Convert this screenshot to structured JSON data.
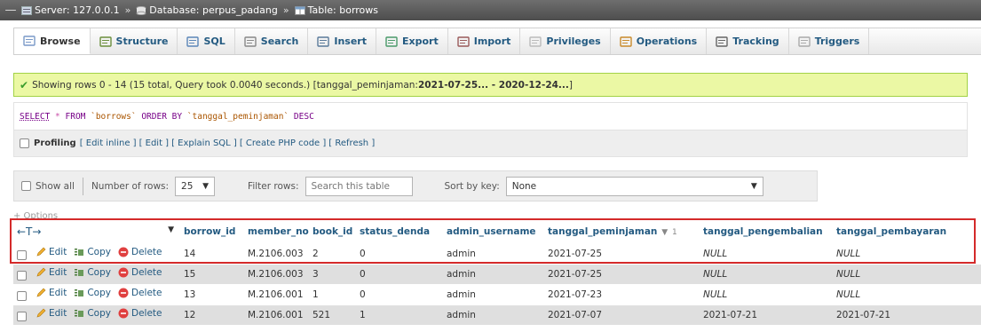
{
  "breadcrumb": {
    "server": "Server: 127.0.0.1",
    "database": "Database: perpus_padang",
    "table": "Table: borrows",
    "separator": "»"
  },
  "tabs": [
    {
      "label": "Browse",
      "icon": "browse-icon",
      "active": true
    },
    {
      "label": "Structure",
      "icon": "structure-icon"
    },
    {
      "label": "SQL",
      "icon": "sql-icon"
    },
    {
      "label": "Search",
      "icon": "search-icon"
    },
    {
      "label": "Insert",
      "icon": "insert-icon"
    },
    {
      "label": "Export",
      "icon": "export-icon"
    },
    {
      "label": "Import",
      "icon": "import-icon"
    },
    {
      "label": "Privileges",
      "icon": "privileges-icon"
    },
    {
      "label": "Operations",
      "icon": "operations-icon"
    },
    {
      "label": "Tracking",
      "icon": "tracking-icon"
    },
    {
      "label": "Triggers",
      "icon": "triggers-icon"
    }
  ],
  "message": {
    "text": "Showing rows 0 - 14 (15 total, Query took 0.0040 seconds.) [tanggal_peminjaman: ",
    "range": "2021-07-25... - 2020-12-24...",
    "end": "]"
  },
  "sql": {
    "select": "SELECT",
    "star": " * ",
    "from": "FROM",
    "table": " `borrows` ",
    "order": "ORDER BY",
    "column": " `tanggal_peminjaman` ",
    "desc": "DESC"
  },
  "profiling": {
    "label": "Profiling",
    "links": [
      "[ Edit inline ]",
      "[ Edit ]",
      "[ Explain SQL ]",
      "[ Create PHP code ]",
      "[ Refresh ]"
    ]
  },
  "nav": {
    "show_all": "Show all",
    "rows_label": "Number of rows:",
    "rows_value": "25",
    "filter_label": "Filter rows:",
    "filter_placeholder": "Search this table",
    "sort_label": "Sort by key:",
    "sort_value": "None"
  },
  "options_label": "+ Options",
  "table": {
    "columns": [
      "borrow_id",
      "member_no",
      "book_id",
      "status_denda",
      "admin_username",
      "tanggal_peminjaman",
      "tanggal_pengembalian",
      "tanggal_pembayaran"
    ],
    "sort_indicator": "1",
    "actions": {
      "edit": "Edit",
      "copy": "Copy",
      "delete": "Delete"
    },
    "rows": [
      [
        "14",
        "M.2106.003",
        "2",
        "0",
        "admin",
        "2021-07-25",
        "NULL",
        "NULL"
      ],
      [
        "15",
        "M.2106.003",
        "3",
        "0",
        "admin",
        "2021-07-25",
        "NULL",
        "NULL"
      ],
      [
        "13",
        "M.2106.001",
        "1",
        "0",
        "admin",
        "2021-07-23",
        "NULL",
        "NULL"
      ],
      [
        "12",
        "M.2106.001",
        "521",
        "1",
        "admin",
        "2021-07-07",
        "2021-07-21",
        "2021-07-21"
      ]
    ]
  },
  "colors": {
    "link": "#235a81",
    "success_bg": "#ebf8a4",
    "highlight": "#d42a2a"
  }
}
